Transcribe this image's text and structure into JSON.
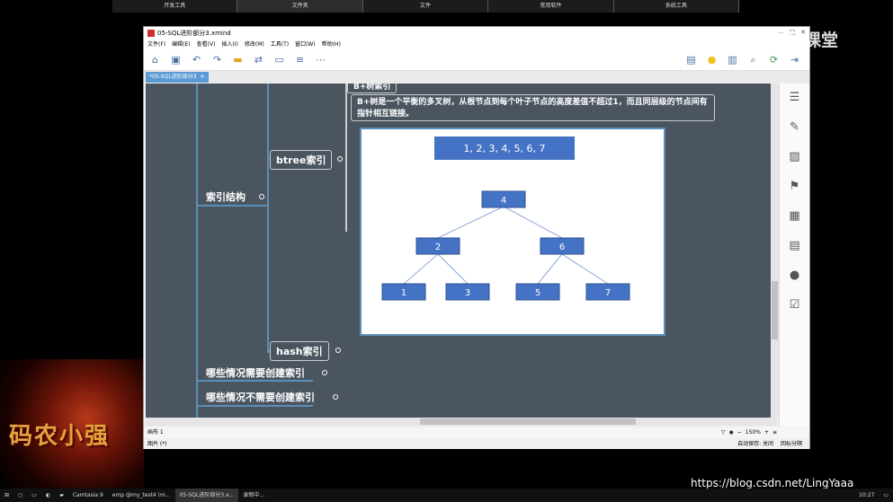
{
  "desktop_top_tabs": [
    "开发工具",
    "文件夹",
    "文件",
    "常用软件",
    "系统工具"
  ],
  "watermark": "腾讯课堂",
  "window": {
    "title": "05-SQL进阶部分3.xmind",
    "controls": [
      "—",
      "□",
      "✕"
    ],
    "menu": [
      "文件(F)",
      "编辑(E)",
      "查看(V)",
      "插入(I)",
      "修改(M)",
      "工具(T)",
      "窗口(W)",
      "帮助(H)"
    ],
    "tab_label": "*05-SQL进阶部分3",
    "tab_close": "✕"
  },
  "toolbar_icons": [
    "home-icon",
    "save-icon",
    "undo-icon",
    "redo-icon",
    "topic-icon",
    "relationship-icon",
    "boundary-icon",
    "summary-icon",
    "more-icon",
    "present-icon",
    "idea-icon",
    "outline-icon",
    "search-icon",
    "share-icon",
    "export-icon"
  ],
  "mindmap": {
    "bplus_label": "B+树索引",
    "bplus_desc": "B+树是一个平衡的多叉树，从根节点到每个叶子节点的高度差值不超过1，而且同层级的节点间有指针相互链接。",
    "btree": "btree索引",
    "index_structure": "索引结构",
    "hash": "hash索引",
    "need_index": "哪些情况需要创建索引",
    "no_need_index": "哪些情况不需要创建索引"
  },
  "tree": {
    "leaf_row": "1, 2, 3, 4, 5, 6, 7",
    "root": "4",
    "left": "2",
    "right": "6",
    "leaves": [
      "1",
      "3",
      "5",
      "7"
    ]
  },
  "status": {
    "sheet": "画布 1",
    "zoom": "150%",
    "autosave": "自动保存: 关闭",
    "picture": "图片 (*)",
    "lock": "回标分隔"
  },
  "taskbar": {
    "items": [
      "Camtasia 9",
      "emp @my_test4 (m...",
      "05-SQL进阶部分3.x...",
      "录制中..."
    ],
    "time": "10:27"
  },
  "csdn_url": "https://blog.csdn.net/LingYaaa",
  "logo_text": "码农小强"
}
